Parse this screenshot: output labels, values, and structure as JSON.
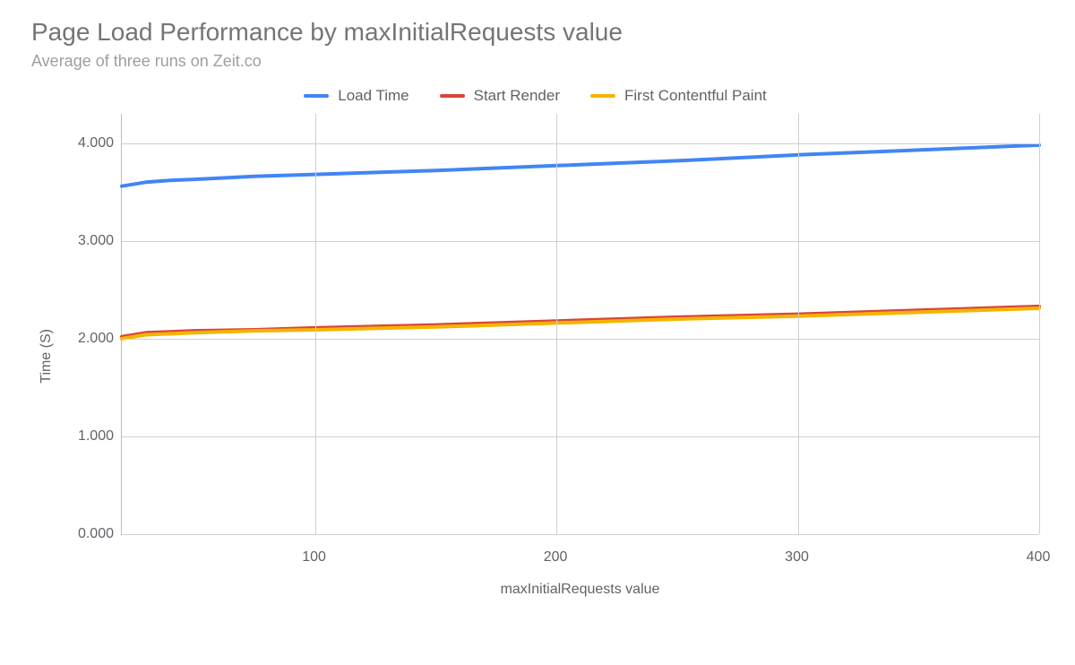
{
  "title": "Page Load Performance by maxInitialRequests value",
  "subtitle": "Average of three runs on Zeit.co",
  "legend": [
    {
      "label": "Load Time",
      "color": "#4285f4"
    },
    {
      "label": "Start Render",
      "color": "#db4437"
    },
    {
      "label": "First Contentful Paint",
      "color": "#f4b400"
    }
  ],
  "yaxis": {
    "label": "Time (S)",
    "ticks": [
      "0.000",
      "1.000",
      "2.000",
      "3.000",
      "4.000"
    ]
  },
  "xaxis": {
    "label": "maxInitialRequests value",
    "ticks": [
      "100",
      "200",
      "300",
      "400"
    ]
  },
  "chart_data": {
    "type": "line",
    "title": "Page Load Performance by maxInitialRequests value",
    "subtitle": "Average of three runs on Zeit.co",
    "xlabel": "maxInitialRequests value",
    "ylabel": "Time (S)",
    "xlim": [
      20,
      400
    ],
    "ylim": [
      0,
      4.3
    ],
    "x": [
      20,
      30,
      40,
      50,
      75,
      100,
      150,
      200,
      250,
      300,
      350,
      400
    ],
    "series": [
      {
        "name": "Load Time",
        "color": "#4285f4",
        "values": [
          3.56,
          3.6,
          3.62,
          3.63,
          3.66,
          3.68,
          3.72,
          3.77,
          3.82,
          3.88,
          3.93,
          3.98
        ]
      },
      {
        "name": "Start Render",
        "color": "#db4437",
        "values": [
          2.02,
          2.06,
          2.07,
          2.08,
          2.09,
          2.11,
          2.14,
          2.18,
          2.22,
          2.25,
          2.29,
          2.33
        ]
      },
      {
        "name": "First Contentful Paint",
        "color": "#f4b400",
        "values": [
          2.0,
          2.04,
          2.05,
          2.06,
          2.08,
          2.09,
          2.12,
          2.16,
          2.2,
          2.23,
          2.27,
          2.31
        ]
      }
    ],
    "xticks": [
      100,
      200,
      300,
      400
    ],
    "yticks": [
      0,
      1,
      2,
      3,
      4
    ],
    "legend_position": "top",
    "grid": true
  }
}
